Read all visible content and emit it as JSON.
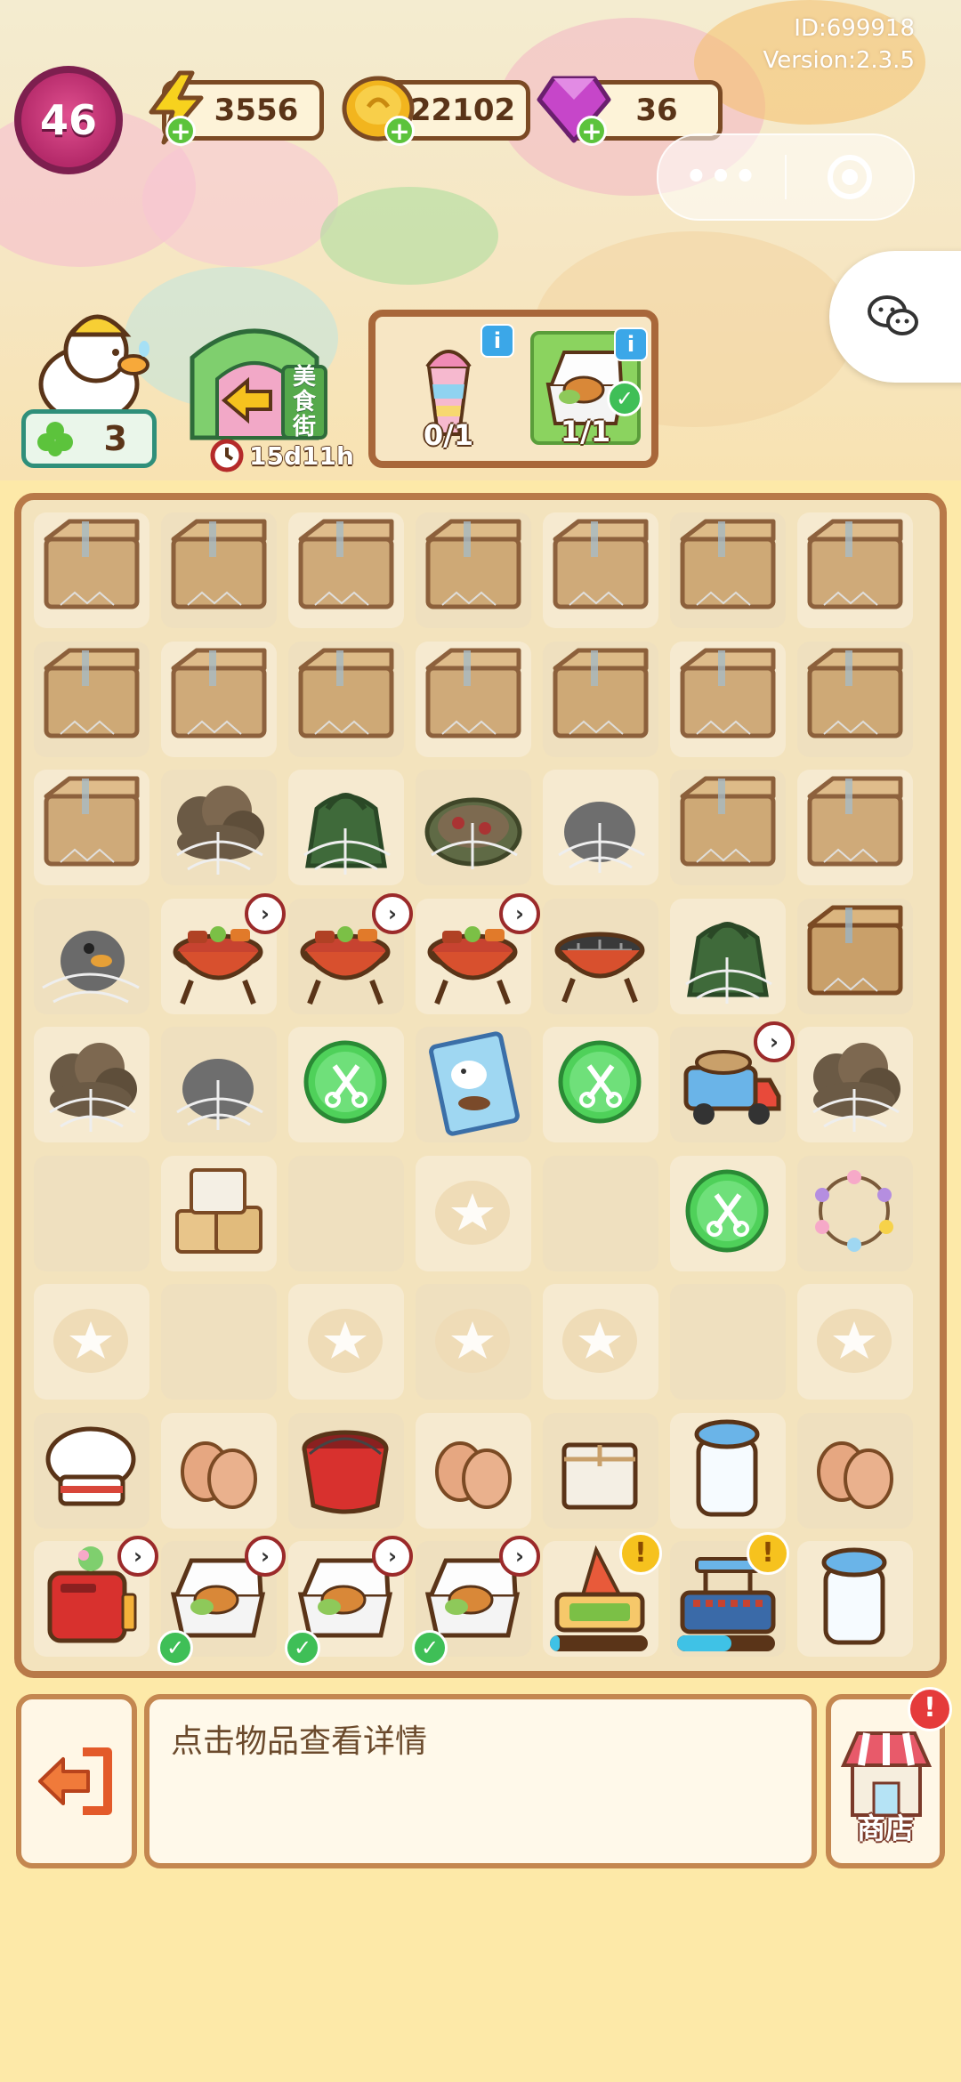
{
  "header": {
    "id_text": "ID:699918",
    "version_text": "Version:2.3.5",
    "level": "46",
    "energy": "3556",
    "coins": "22102",
    "gems": "36",
    "capsule_more": "•••",
    "clover_count": "3",
    "event_sign": "美食街",
    "event_timer": "15d11h"
  },
  "orders": [
    {
      "item": "rainbow-drink",
      "progress": "0/1",
      "completed": false
    },
    {
      "item": "takeout-box",
      "progress": "1/1",
      "completed": true
    }
  ],
  "board": {
    "rows": [
      [
        "box",
        "box",
        "box",
        "box",
        "box",
        "box",
        "box"
      ],
      [
        "box",
        "box",
        "box",
        "box",
        "box",
        "box",
        "box"
      ],
      [
        "box",
        "webbed-cloud",
        "webbed-bag",
        "webbed-pizza",
        "webbed-stone",
        "box",
        "box"
      ],
      [
        "webbed-bird",
        "bbq-grill",
        "bbq-grill",
        "bbq-grill",
        "empty-grill",
        "webbed-bag",
        "box"
      ],
      [
        "webbed-cloud",
        "webbed-stone",
        "scissors",
        "poster",
        "scissors",
        "delivery-truck",
        "webbed-cloud"
      ],
      [
        "",
        "box-stack",
        "",
        "star-slot",
        "",
        "scissors",
        "flower-wreath"
      ],
      [
        "star-slot",
        "",
        "star-slot",
        "star-slot",
        "star-slot",
        "",
        "star-slot"
      ],
      [
        "chef-hat",
        "eggs",
        "red-bucket",
        "eggs",
        "small-box",
        "milk-jar",
        "eggs"
      ],
      [
        "toaster",
        "takeout-box",
        "takeout-box",
        "takeout-box",
        "cart-generator",
        "bbq-cart",
        "milk-jar"
      ]
    ],
    "generator_progress": [
      0.1,
      0.55
    ]
  },
  "footer": {
    "hint": "点击物品查看详情",
    "shop_label": "商店",
    "shop_alert": "!"
  },
  "colors": {
    "board_border": "#b87948",
    "accent_green": "#3fbf57",
    "level_pink": "#b52a6a"
  }
}
